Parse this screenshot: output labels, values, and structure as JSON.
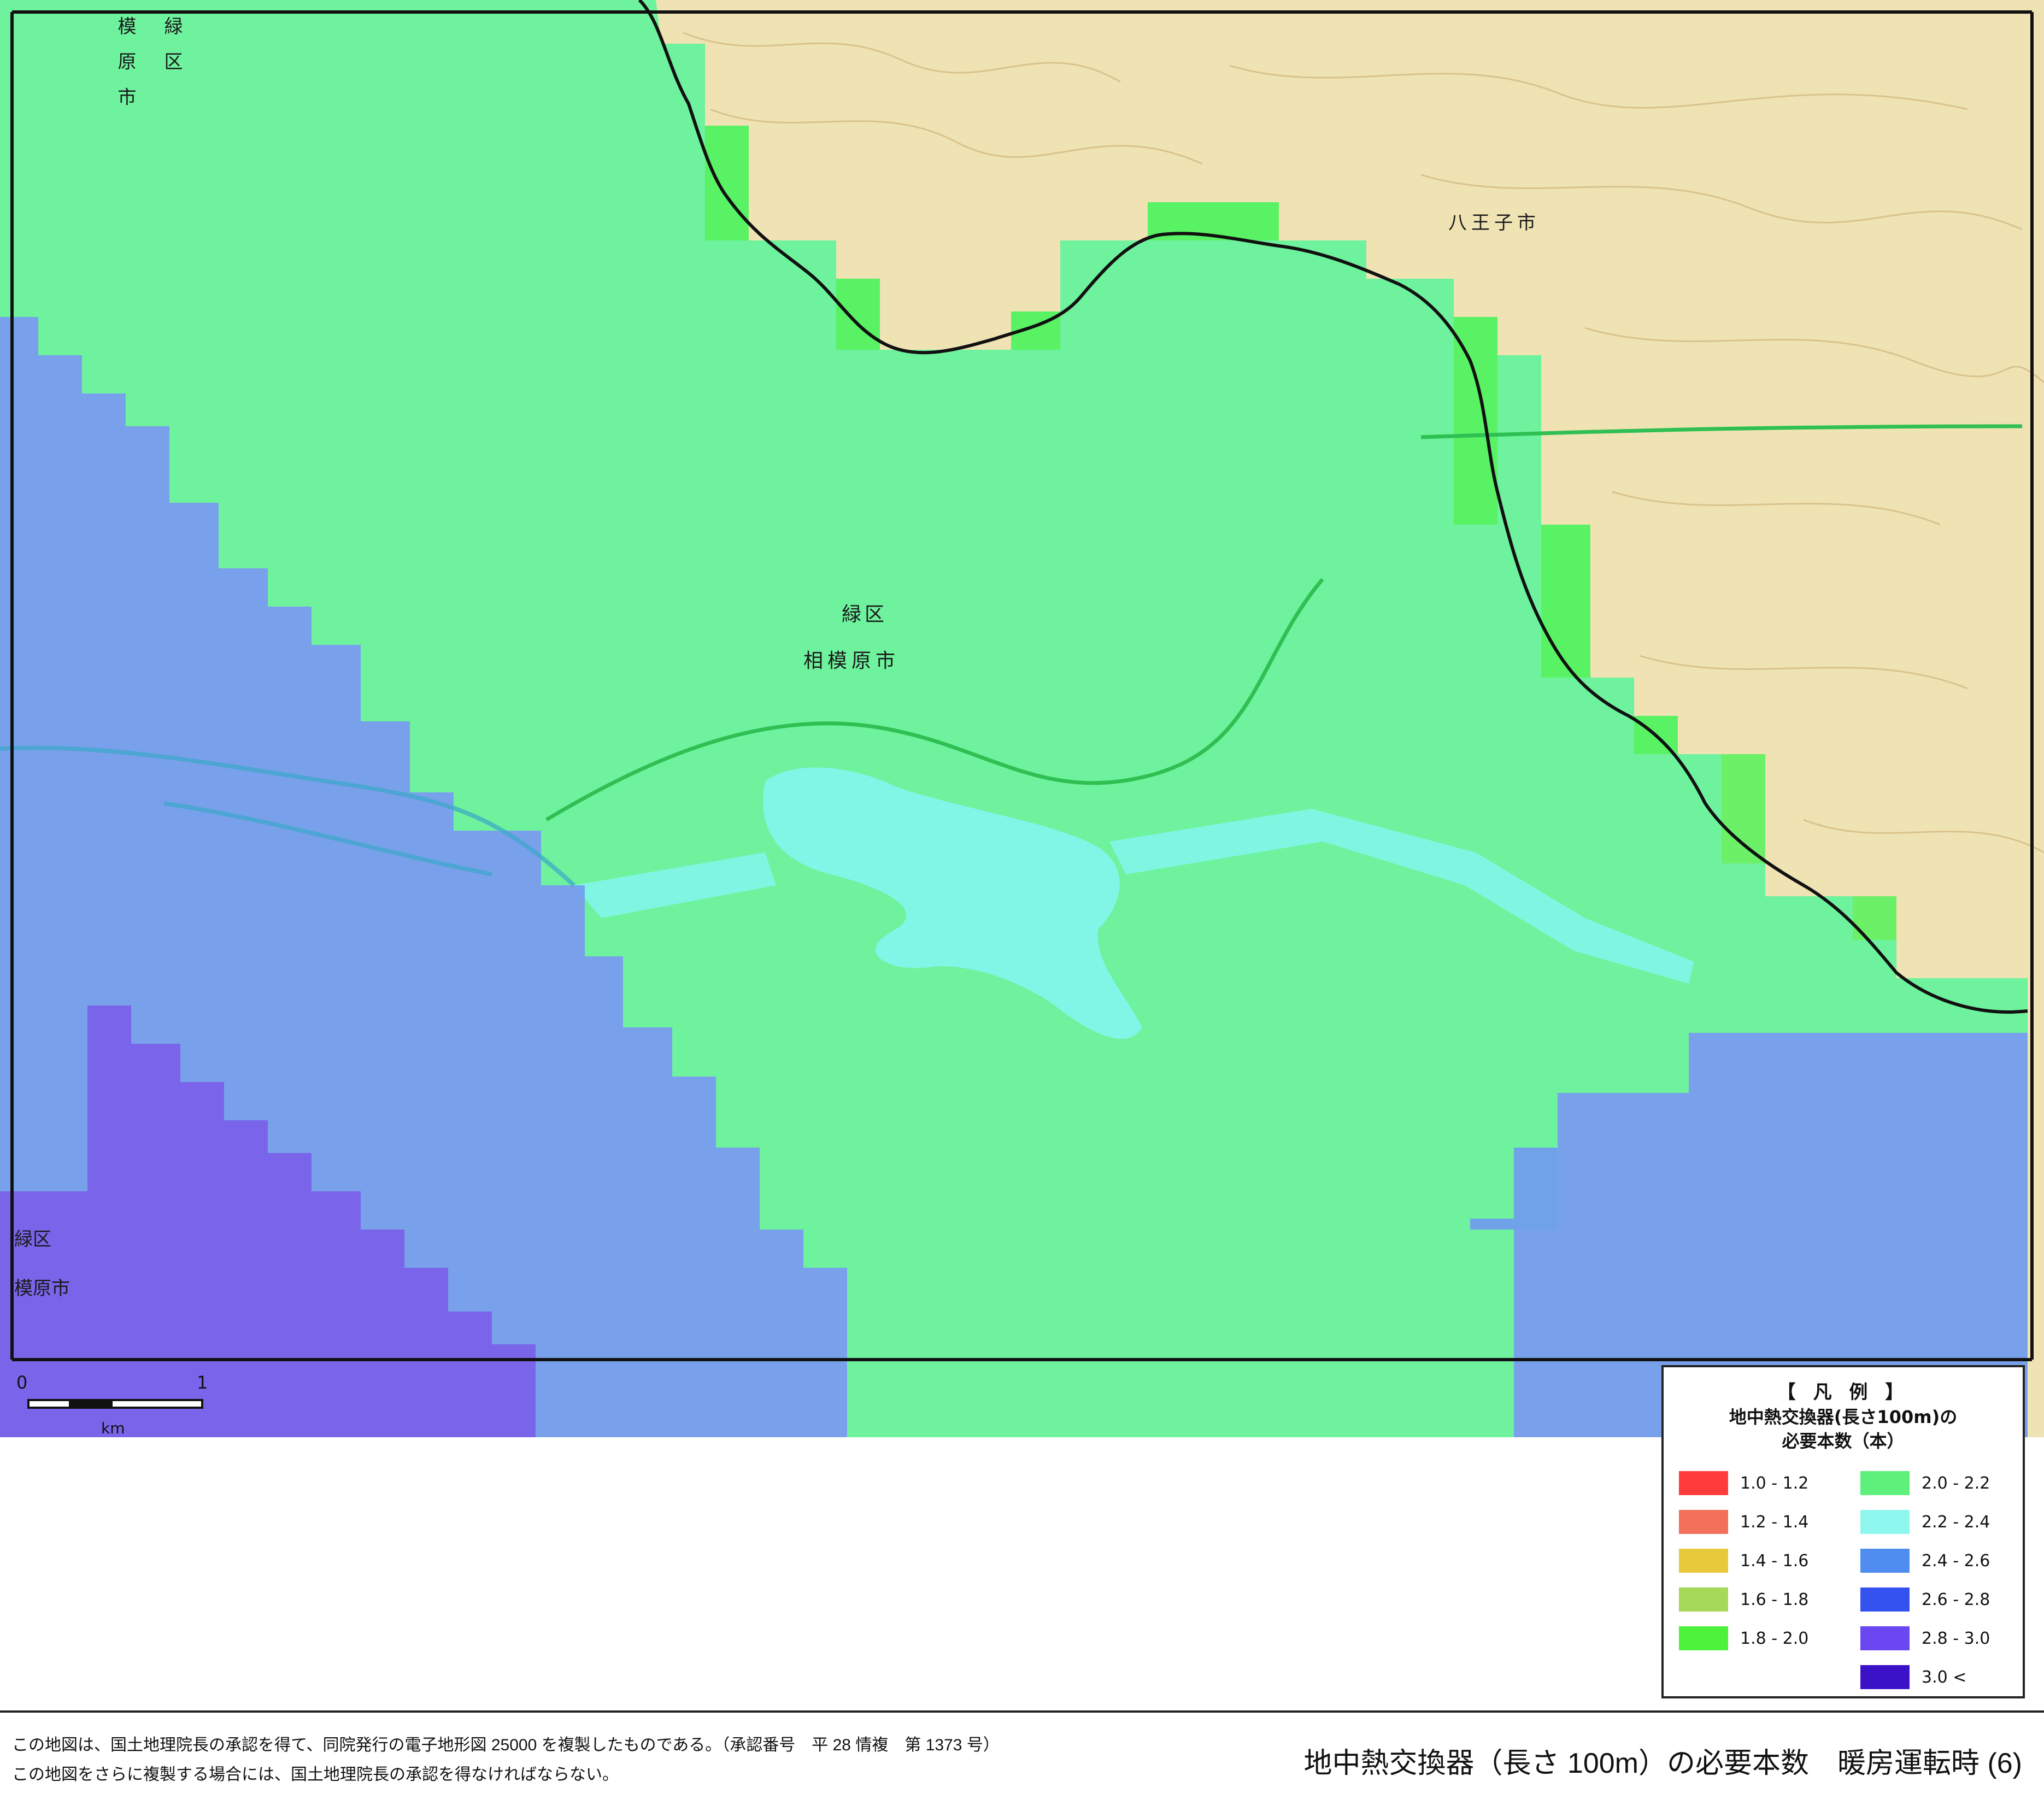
{
  "map": {
    "area_labels": {
      "midori_ku_center": "緑区",
      "sagamihara_center": "相模原市",
      "hachioji": "八王子市",
      "midori_ku_topleft": "緑 区",
      "sagamihara_topleft": "模 原 市",
      "midori_ku_left": "緑区",
      "sagamihara_left": "模原市"
    },
    "scale_bar": {
      "start": "0",
      "end": "1",
      "unit": "km"
    },
    "colors": {
      "band_1_8_2_0": "#55f25a",
      "band_2_0_2_2": "#63f39b",
      "band_2_2_2_4": "#82f6ea",
      "band_2_4_2_6": "#6f9bf0",
      "band_2_8_3_0": "#7b5ee9",
      "terrain": "#efe3b4",
      "boundary": "#111111"
    }
  },
  "legend": {
    "title": "【 凡 例 】",
    "subtitle_line1": "地中熱交換器(長さ100m)の",
    "subtitle_line2": "必要本数（本）",
    "items": [
      {
        "label": "1.0 - 1.2",
        "color": "#ff3b3b"
      },
      {
        "label": "1.2 - 1.4",
        "color": "#f2705a"
      },
      {
        "label": "1.4 - 1.6",
        "color": "#e8c93a"
      },
      {
        "label": "1.6 - 1.8",
        "color": "#a6d85a"
      },
      {
        "label": "1.8 - 2.0",
        "color": "#4cf23c"
      },
      {
        "label": "2.0 - 2.2",
        "color": "#5ef07a"
      },
      {
        "label": "2.2 - 2.4",
        "color": "#8ef8ef"
      },
      {
        "label": "2.4 - 2.6",
        "color": "#4f8ef0"
      },
      {
        "label": "2.6 - 2.8",
        "color": "#3452f0"
      },
      {
        "label": "2.8 - 3.0",
        "color": "#6a47f0"
      },
      {
        "label": "3.0 <",
        "color": "#3c12c8"
      }
    ]
  },
  "footer": {
    "note1": "この地図は、国土地理院長の承認を得て、同院発行の電子地形図 25000 を複製したものである。（承認番号　平 28 情複　第 1373 号）",
    "note2": "この地図をさらに複製する場合には、国土地理院長の承認を得なければならない。",
    "title": "地中熱交換器（長さ 100m）の必要本数　暖房運転時 (6)"
  }
}
